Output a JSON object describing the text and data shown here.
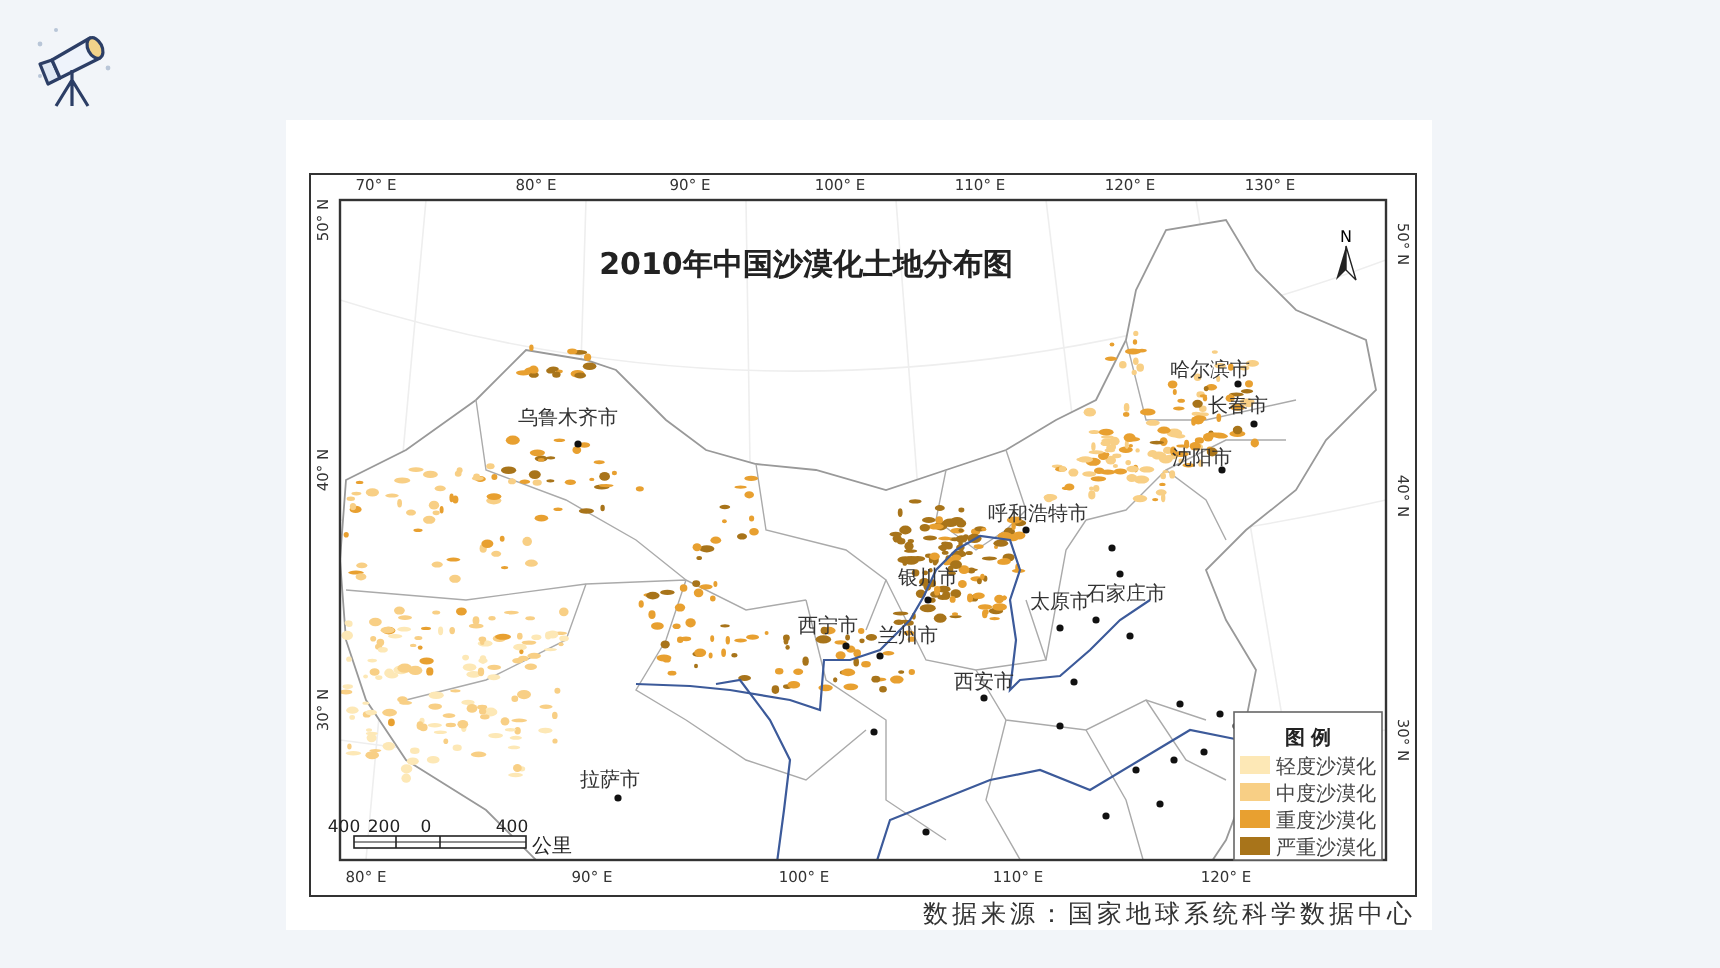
{
  "map": {
    "title": "2010年中国沙漠化土地分布图",
    "north_label": "N",
    "top_ticks": [
      "70° E",
      "80° E",
      "90° E",
      "100° E",
      "110° E",
      "120° E",
      "130° E"
    ],
    "bottom_ticks": [
      "80° E",
      "90° E",
      "100° E",
      "110° E",
      "120° E"
    ],
    "left_ticks": [
      "50° N",
      "40° N",
      "30° N"
    ],
    "right_ticks": [
      "50° N",
      "40° N",
      "30° N"
    ],
    "cities": [
      {
        "name": "哈尔滨市"
      },
      {
        "name": "长春市"
      },
      {
        "name": "沈阳市"
      },
      {
        "name": "乌鲁木齐市"
      },
      {
        "name": "呼和浩特市"
      },
      {
        "name": "银川市"
      },
      {
        "name": "太原市"
      },
      {
        "name": "石家庄市"
      },
      {
        "name": "西宁市"
      },
      {
        "name": "兰州市"
      },
      {
        "name": "西安市"
      },
      {
        "name": "拉萨市"
      }
    ],
    "scale": {
      "labels": [
        "400",
        "200",
        "0",
        "400"
      ],
      "unit": "公里"
    },
    "legend": {
      "title": "图 例",
      "items": [
        {
          "label": "轻度沙漠化",
          "color": "#fde8b6"
        },
        {
          "label": "中度沙漠化",
          "color": "#f8cf85"
        },
        {
          "label": "重度沙漠化",
          "color": "#e8a030"
        },
        {
          "label": "严重沙漠化",
          "color": "#a8741a"
        }
      ]
    }
  },
  "source": "数据来源：国家地球系统科学数据中心"
}
